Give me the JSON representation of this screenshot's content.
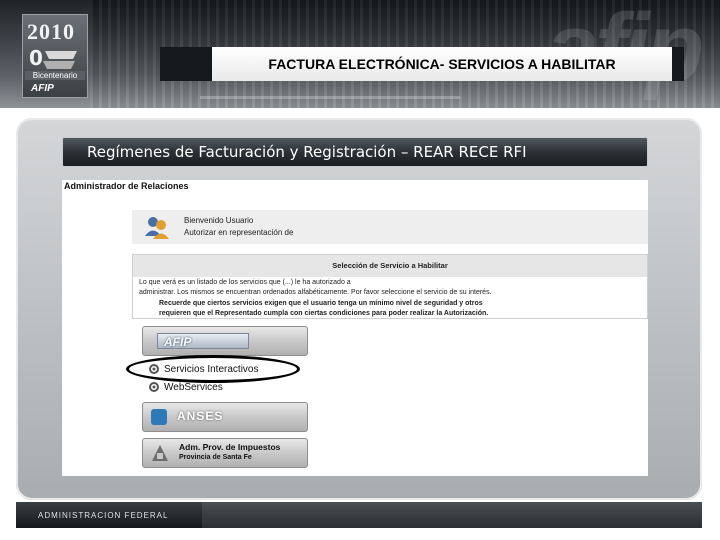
{
  "banner": {
    "logo_year": "2010",
    "logo_caption": "Bicentenario",
    "logo_afip": "AFIP",
    "title": "FACTURA ELECTRÓNICA-  SERVICIOS A HABILITAR"
  },
  "section": {
    "title": "Regímenes de Facturación y Registración – REAR RECE RFI"
  },
  "screenshot": {
    "admin_title": "Administrador de Relaciones",
    "user": {
      "line1": "Bienvenido Usuario",
      "line2": "Autorizar en representación de"
    },
    "selection": {
      "title": "Selección de Servicio a Habilitar",
      "text1": "Lo que verá es un listado de los servicios que (...) le ha autorizado a",
      "text2": "administrar. Los mismos se encuentran ordenados alfabéticamente. Por favor seleccione el servicio de su interés.",
      "bold1": "Recuerde que ciertos servicios exigen que el usuario tenga un mínimo nivel de seguridad y otros",
      "bold2": "requieren que el Representado cumpla con ciertas condiciones para poder realizar la Autorización."
    },
    "services": {
      "afip_label": "AFIP",
      "link1": "Servicios Interactivos",
      "link2": "WebServices",
      "anses_label": "ANSES",
      "adm_line1": "Adm. Prov. de Impuestos",
      "adm_line2": "Provincia de Santa Fe"
    }
  },
  "footer": {
    "label": "ADMINISTRACION FEDERAL"
  }
}
